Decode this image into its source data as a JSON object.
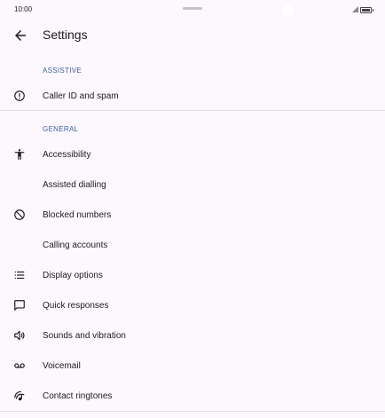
{
  "status": {
    "time": "10:00"
  },
  "header": {
    "title": "Settings"
  },
  "sections": {
    "assistive": {
      "title": "ASSISTIVE",
      "items": [
        {
          "label": "Caller ID and spam",
          "icon": "info-circle-icon"
        }
      ]
    },
    "general": {
      "title": "GENERAL",
      "items": [
        {
          "label": "Accessibility",
          "icon": "accessibility-icon"
        },
        {
          "label": "Assisted dialling",
          "icon": ""
        },
        {
          "label": "Blocked numbers",
          "icon": "block-icon"
        },
        {
          "label": "Calling accounts",
          "icon": ""
        },
        {
          "label": "Display options",
          "icon": "list-icon"
        },
        {
          "label": "Quick responses",
          "icon": "message-icon"
        },
        {
          "label": "Sounds and vibration",
          "icon": "volume-icon"
        },
        {
          "label": "Voicemail",
          "icon": "voicemail-icon"
        },
        {
          "label": "Contact ringtones",
          "icon": "ringtone-icon"
        }
      ]
    }
  },
  "colors": {
    "background": "#fcf8fd",
    "section_header": "#3f5fa0",
    "text": "#1c1b1f",
    "divider": "#e3e0e6"
  }
}
